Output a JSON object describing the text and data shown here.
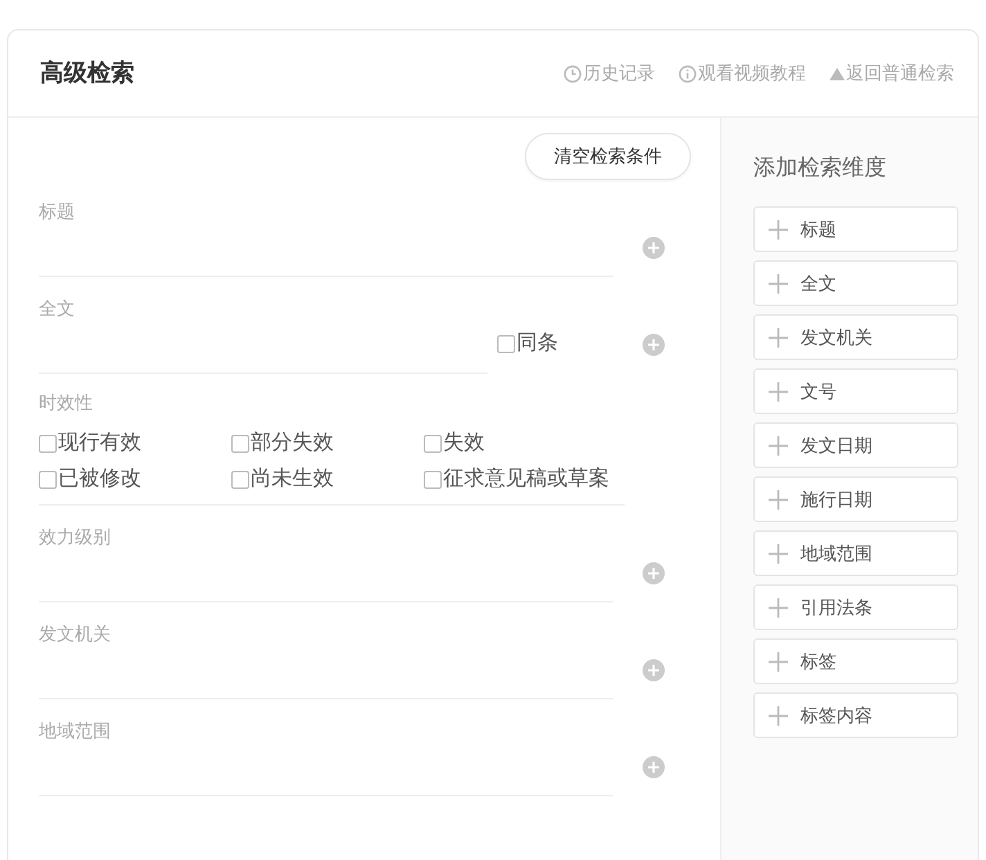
{
  "header": {
    "title": "高级检索",
    "links": [
      {
        "kind": "history",
        "label": "历史记录"
      },
      {
        "kind": "info",
        "label": "观看视频教程"
      },
      {
        "kind": "back",
        "label": "返回普通检索"
      }
    ]
  },
  "clear_button": "清空检索条件",
  "fields": [
    {
      "kind": "input",
      "label": "标题"
    },
    {
      "kind": "input",
      "label": "全文",
      "same_article": {
        "label": "同条",
        "checked": false
      }
    },
    {
      "kind": "checkboxes",
      "label": "时效性",
      "options": [
        {
          "label": "现行有效",
          "checked": false
        },
        {
          "label": "部分失效",
          "checked": false
        },
        {
          "label": "失效",
          "checked": false
        },
        {
          "label": "已被修改",
          "checked": false
        },
        {
          "label": "尚未生效",
          "checked": false
        },
        {
          "label": "征求意见稿或草案",
          "checked": false
        }
      ]
    },
    {
      "kind": "input",
      "label": "效力级别"
    },
    {
      "kind": "input",
      "label": "发文机关"
    },
    {
      "kind": "input",
      "label": "地域范围"
    }
  ],
  "dimensions": {
    "title": "添加检索维度",
    "items": [
      "标题",
      "全文",
      "发文机关",
      "文号",
      "发文日期",
      "施行日期",
      "地域范围",
      "引用法条",
      "标签",
      "标签内容"
    ]
  }
}
